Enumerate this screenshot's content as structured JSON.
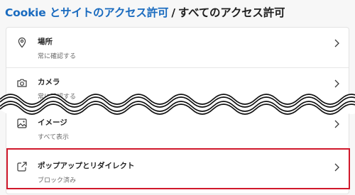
{
  "breadcrumb": {
    "parent": "Cookie とサイトのアクセス許可",
    "separator": "/",
    "current": "すべてのアクセス許可"
  },
  "permissions": [
    {
      "title": "場所",
      "subtitle": "常に確認する",
      "icon": "location-pin-icon"
    },
    {
      "title": "カメラ",
      "subtitle": "常に確認する",
      "icon": "camera-icon"
    },
    {
      "title": "イメージ",
      "subtitle": "すべて表示",
      "icon": "image-icon"
    },
    {
      "title": "ポップアップとリダイレクト",
      "subtitle": "ブロック済み",
      "icon": "external-link-icon"
    }
  ],
  "colors": {
    "link": "#1a6bbf",
    "highlight": "#d0182b",
    "background": "#f7f7f7"
  }
}
